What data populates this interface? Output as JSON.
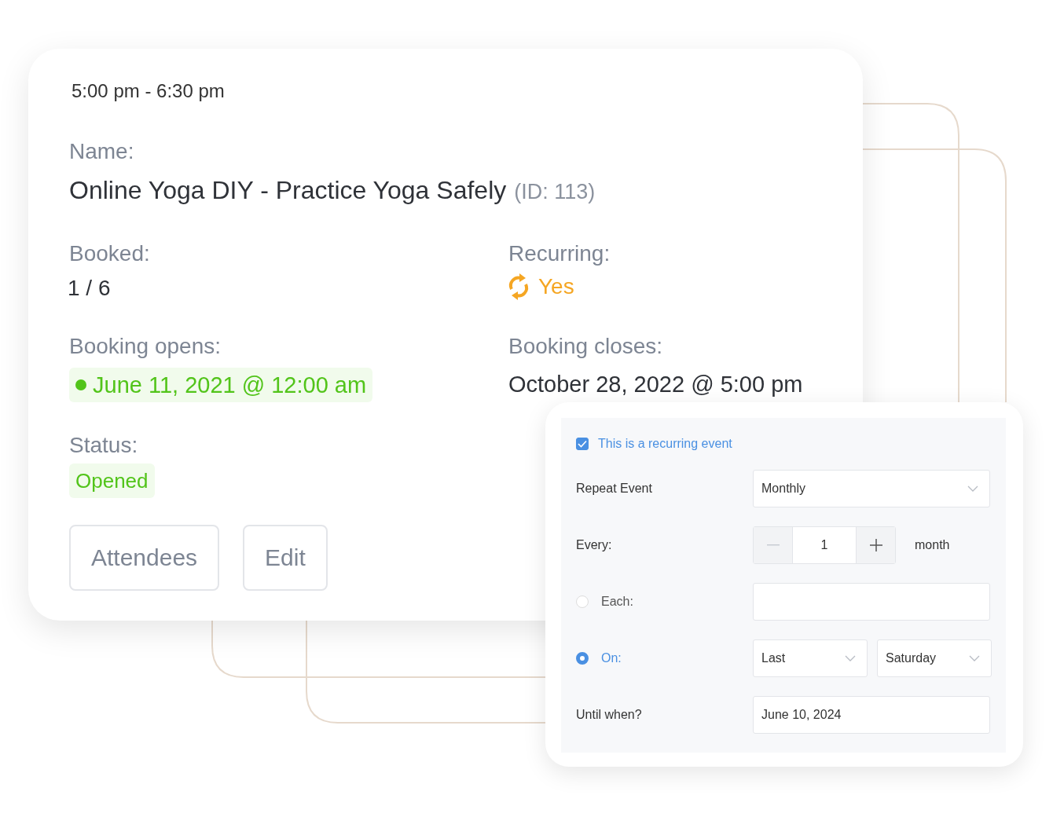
{
  "event_card": {
    "time": "5:00 pm - 6:30 pm",
    "name_label": "Name:",
    "name": "Online Yoga DIY - Practice Yoga Safely",
    "id": "(ID: 113)",
    "fields": [
      {
        "kind": "plain",
        "label": "Booked:",
        "value": "1 / 6"
      },
      {
        "kind": "recurring",
        "label": "Recurring:",
        "value": "Yes"
      },
      {
        "kind": "open-date",
        "label": "Booking opens:",
        "value": "June 11, 2021 @ 12:00 am"
      },
      {
        "kind": "plain",
        "label": "Booking closes:",
        "value": "October 28, 2022 @ 5:00 pm"
      }
    ],
    "status": {
      "label": "Status:",
      "value": "Opened"
    },
    "buttons": [
      "Attendees",
      "Edit"
    ]
  },
  "recurrence_form": {
    "checkbox": {
      "label": "This is a recurring event",
      "checked": true
    },
    "repeat": {
      "label": "Repeat Event",
      "value": "Monthly"
    },
    "every": {
      "label": "Every:",
      "value": "1",
      "unit": "month"
    },
    "options": [
      {
        "kind": "each",
        "label": "Each:",
        "selected": false
      },
      {
        "kind": "on",
        "label": "On:",
        "selected": true,
        "values": [
          "Last",
          "Saturday"
        ]
      }
    ],
    "until": {
      "label": "Until when?",
      "value": "June 10, 2024"
    }
  }
}
